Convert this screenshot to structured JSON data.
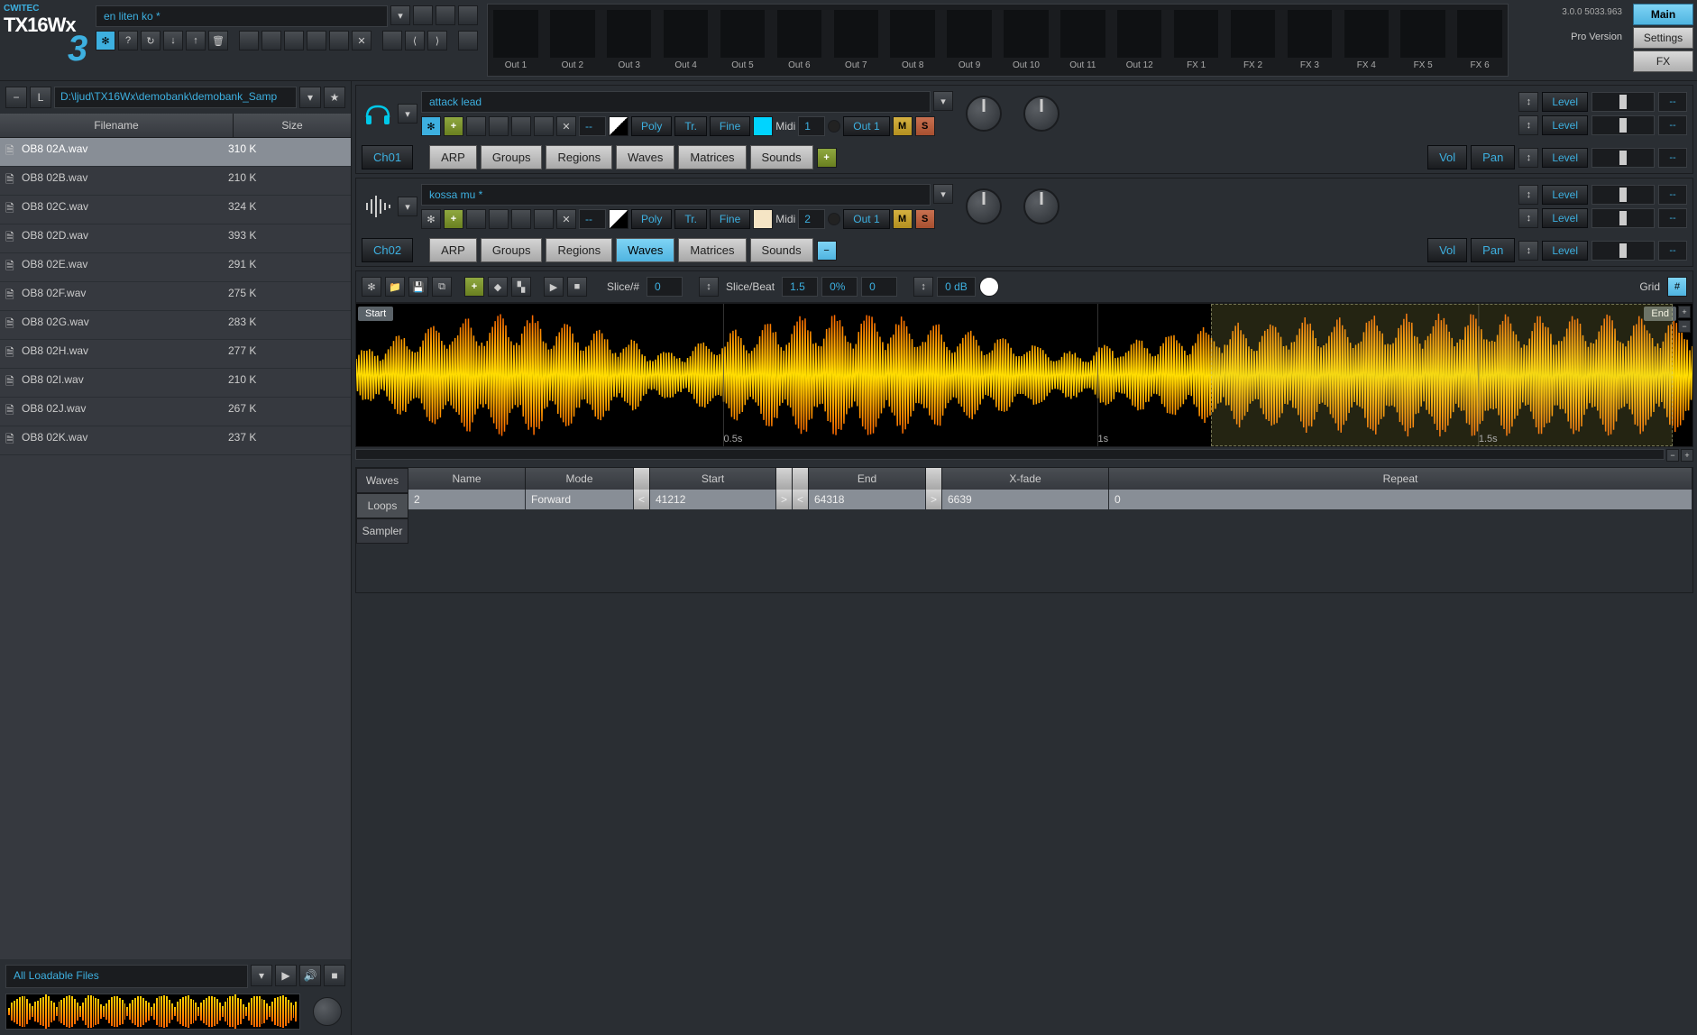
{
  "app": {
    "brand": "CWITEC",
    "name": "TX16Wx",
    "edition_num": "3"
  },
  "version": {
    "text": "3.0.0 5033.963",
    "edition": "Pro Version"
  },
  "right_buttons": {
    "main": "Main",
    "settings": "Settings",
    "fx": "FX"
  },
  "title": {
    "patch": "en liten ko *"
  },
  "outputs": [
    "Out 1",
    "Out 2",
    "Out 3",
    "Out 4",
    "Out 5",
    "Out 6",
    "Out 7",
    "Out 8",
    "Out 9",
    "Out 10",
    "Out 11",
    "Out 12",
    "FX 1",
    "FX 2",
    "FX 3",
    "FX 4",
    "FX 5",
    "FX 6"
  ],
  "browser": {
    "path": "D:\\ljud\\TX16Wx\\demobank\\demobank_Samp",
    "columns": {
      "filename": "Filename",
      "size": "Size"
    },
    "files": [
      {
        "name": "OB8 02A.wav",
        "size": "310 K",
        "selected": true
      },
      {
        "name": "OB8 02B.wav",
        "size": "210 K"
      },
      {
        "name": "OB8 02C.wav",
        "size": "324 K"
      },
      {
        "name": "OB8 02D.wav",
        "size": "393 K"
      },
      {
        "name": "OB8 02E.wav",
        "size": "291 K"
      },
      {
        "name": "OB8 02F.wav",
        "size": "275 K"
      },
      {
        "name": "OB8 02G.wav",
        "size": "283 K"
      },
      {
        "name": "OB8 02H.wav",
        "size": "277 K"
      },
      {
        "name": "OB8 02I.wav",
        "size": "210 K"
      },
      {
        "name": "OB8 02J.wav",
        "size": "267 K"
      },
      {
        "name": "OB8 02K.wav",
        "size": "237 K"
      }
    ],
    "filter": "All Loadable Files"
  },
  "channels": [
    {
      "id": "Ch01",
      "icon": "headphones",
      "name": "attack lead",
      "poly": "Poly",
      "tr": "Tr.",
      "fine": "Fine",
      "color": "#00d4ff",
      "midi_label": "Midi",
      "midi_ch": "1",
      "out": "Out 1",
      "mute": "M",
      "solo": "S",
      "tabs": [
        "ARP",
        "Groups",
        "Regions",
        "Waves",
        "Matrices",
        "Sounds"
      ],
      "active_tab": -1,
      "vol": "Vol",
      "pan": "Pan",
      "level": "Level",
      "dash": "--"
    },
    {
      "id": "Ch02",
      "icon": "wave",
      "name": "kossa mu *",
      "poly": "Poly",
      "tr": "Tr.",
      "fine": "Fine",
      "color": "#f5e5c5",
      "midi_label": "Midi",
      "midi_ch": "2",
      "out": "Out 1",
      "mute": "M",
      "solo": "S",
      "tabs": [
        "ARP",
        "Groups",
        "Regions",
        "Waves",
        "Matrices",
        "Sounds"
      ],
      "active_tab": 3,
      "vol": "Vol",
      "pan": "Pan",
      "level": "Level",
      "dash": "--"
    }
  ],
  "wave_toolbar": {
    "slice_num_label": "Slice/#",
    "slice_num": "0",
    "slice_beat_label": "Slice/Beat",
    "slice_beat": "1.5",
    "pct": "0%",
    "offset": "0",
    "db": "0 dB",
    "grid_label": "Grid"
  },
  "waveform": {
    "start_label": "Start",
    "end_label": "End",
    "times": [
      "0.5s",
      "1s",
      "1.5s"
    ]
  },
  "loops": {
    "side_tabs": [
      "Waves",
      "Loops",
      "Sampler"
    ],
    "active_side": 1,
    "columns": {
      "name": "Name",
      "mode": "Mode",
      "start": "Start",
      "end": "End",
      "xfade": "X-fade",
      "repeat": "Repeat"
    },
    "rows": [
      {
        "name": "2",
        "mode": "Forward",
        "start": "41212",
        "end": "64318",
        "xfade": "6639",
        "repeat": "0"
      }
    ]
  },
  "glyphs": {
    "dropdown": "▾",
    "gear": "✻",
    "help": "?",
    "loop": "↻",
    "down": "↓",
    "up": "↑",
    "trash": "🗑",
    "add": "▤",
    "x": "✕",
    "prev": "◀",
    "next": "▶",
    "back": "⟨",
    "fwd": "⟩",
    "star": "★",
    "play": "▶",
    "vol": "🔊",
    "stop": "■",
    "link": "↕",
    "minus": "−",
    "plus": "+",
    "grid": "#",
    "wave": "∿",
    "folder": "📁",
    "save": "💾",
    "copy": "⧉",
    "lt": "<",
    "gt": ">",
    "doc": "🗎",
    "diamond": "◆",
    "chart": "▚"
  }
}
